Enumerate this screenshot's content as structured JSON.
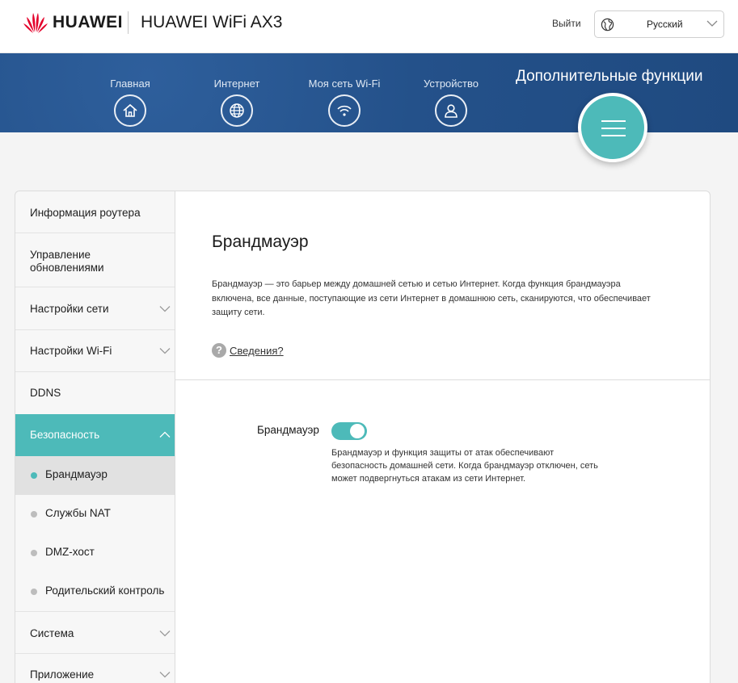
{
  "header": {
    "brand": "HUAWEI",
    "product": "HUAWEI WiFi AX3",
    "logout_label": "Выйти",
    "language": {
      "selected": "Русский"
    }
  },
  "nav": {
    "items": [
      {
        "label": "Главная",
        "icon": "home-icon"
      },
      {
        "label": "Интернет",
        "icon": "globe-icon"
      },
      {
        "label": "Моя сеть Wi-Fi",
        "icon": "wifi-icon"
      },
      {
        "label": "Устройство",
        "icon": "user-icon"
      }
    ],
    "active_label": "Дополнительные функции",
    "active_icon": "menu-icon"
  },
  "sidebar": {
    "items": [
      {
        "label": "Информация роутера"
      },
      {
        "label": "Управление обновлениями"
      },
      {
        "label": "Настройки сети"
      },
      {
        "label": "Настройки Wi-Fi"
      },
      {
        "label": "DDNS"
      },
      {
        "label": "Безопасность"
      },
      {
        "label": "Система"
      },
      {
        "label": "Приложение"
      }
    ],
    "security_sub": [
      {
        "label": "Брандмауэр"
      },
      {
        "label": "Службы NAT"
      },
      {
        "label": "DMZ-хост"
      },
      {
        "label": "Родительский контроль"
      }
    ]
  },
  "main": {
    "title": "Брандмауэр",
    "description": "Брандмауэр — это барьер между домашней сетью и сетью Интернет. Когда функция брандмауэра включена, все данные, поступающие из сети Интернет в домашнюю сеть, сканируются, что обеспечивает защиту сети.",
    "help_label": "Сведения?",
    "help_icon_glyph": "?",
    "firewall": {
      "label": "Брандмауэр",
      "enabled": true,
      "note": "Брандмауэр и функция защиты от атак обеспечивают безопасность домашней сети. Когда брандмауэр отключен, сеть может подвергнуться атакам из сети Интернет."
    }
  },
  "colors": {
    "accent": "#4dbab9",
    "nav_band": "#24518a",
    "brand_red": "#e4002b"
  }
}
